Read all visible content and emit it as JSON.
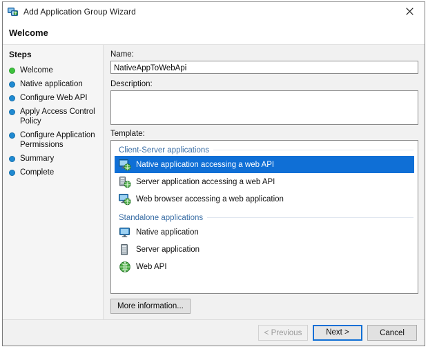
{
  "window": {
    "title": "Add Application Group Wizard",
    "title_icon": "app-group-icon",
    "close_icon": "close-icon",
    "header_title": "Welcome"
  },
  "sidebar": {
    "title": "Steps",
    "items": [
      {
        "label": "Welcome",
        "state": "current",
        "bullet_color": "#3dc23d"
      },
      {
        "label": "Native application",
        "state": "pending",
        "bullet_color": "#1f8ad2"
      },
      {
        "label": "Configure Web API",
        "state": "pending",
        "bullet_color": "#1f8ad2"
      },
      {
        "label": "Apply Access Control Policy",
        "state": "pending",
        "bullet_color": "#1f8ad2"
      },
      {
        "label": "Configure Application Permissions",
        "state": "pending",
        "bullet_color": "#1f8ad2"
      },
      {
        "label": "Summary",
        "state": "pending",
        "bullet_color": "#1f8ad2"
      },
      {
        "label": "Complete",
        "state": "pending",
        "bullet_color": "#1f8ad2"
      }
    ]
  },
  "form": {
    "name_label": "Name:",
    "name_value": "NativeAppToWebApi",
    "name_placeholder": "",
    "description_label": "Description:",
    "description_value": "",
    "description_placeholder": "",
    "template_label": "Template:"
  },
  "template_list": {
    "groups": [
      {
        "header": "Client-Server applications",
        "items": [
          {
            "label": "Native application accessing a web API",
            "icon": "monitor-globe-icon",
            "selected": true
          },
          {
            "label": "Server application accessing a web API",
            "icon": "server-globe-icon",
            "selected": false
          },
          {
            "label": "Web browser accessing a web application",
            "icon": "monitor-globe-icon",
            "selected": false
          }
        ]
      },
      {
        "header": "Standalone applications",
        "items": [
          {
            "label": "Native application",
            "icon": "monitor-icon",
            "selected": false
          },
          {
            "label": "Server application",
            "icon": "server-icon",
            "selected": false
          },
          {
            "label": "Web API",
            "icon": "globe-icon",
            "selected": false
          }
        ]
      }
    ]
  },
  "actions": {
    "more_information": "More information...",
    "previous": "< Previous",
    "next": "Next >",
    "cancel": "Cancel"
  },
  "colors": {
    "selection_blue": "#0f6fd6",
    "group_header_blue": "#3a6ea5",
    "current_step_green": "#3dc23d",
    "pending_step_blue": "#1f8ad2",
    "dialog_bg": "#f1f1f1"
  }
}
